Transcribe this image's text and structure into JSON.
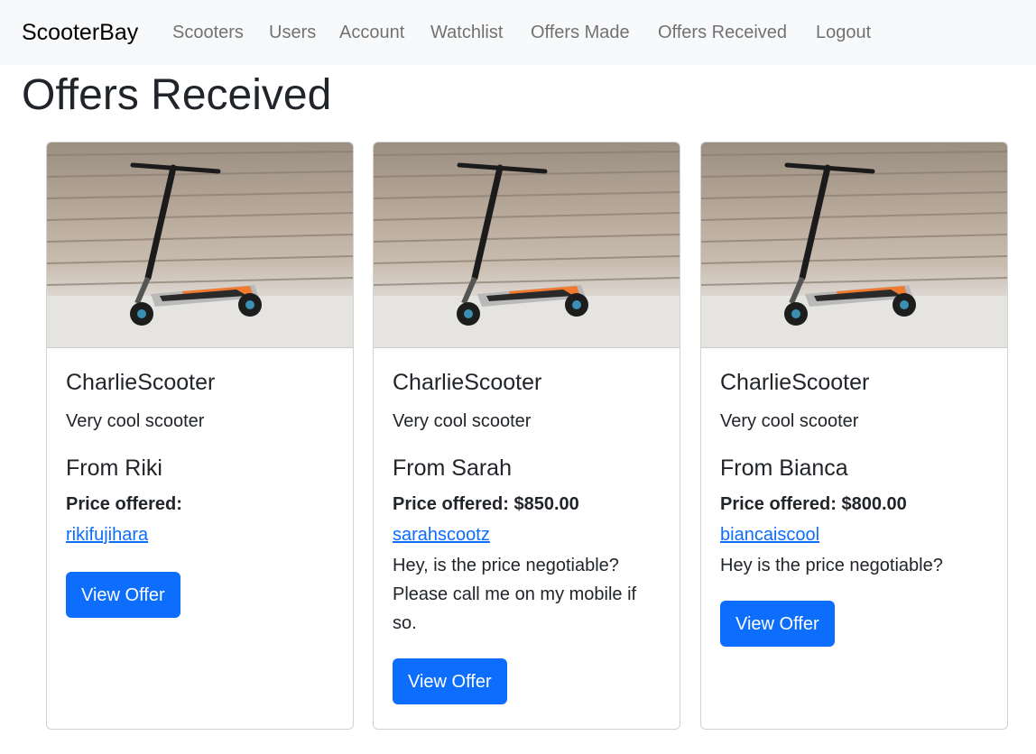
{
  "navbar": {
    "brand": "ScooterBay",
    "links": [
      "Scooters",
      "Users",
      "Account",
      "Watchlist",
      "Offers Made",
      "Offers Received",
      "Logout"
    ]
  },
  "page": {
    "title": "Offers Received"
  },
  "offers": [
    {
      "scooter_name": "CharlieScooter",
      "description": "Very cool scooter",
      "from": "From Riki",
      "price": "Price offered:",
      "username": "rikifujihara",
      "message": "",
      "button": "View Offer"
    },
    {
      "scooter_name": "CharlieScooter",
      "description": "Very cool scooter",
      "from": "From Sarah",
      "price": "Price offered: $850.00",
      "username": "sarahscootz",
      "message": "Hey, is the price negotiable? Please call me on my mobile if so.",
      "button": "View Offer"
    },
    {
      "scooter_name": "CharlieScooter",
      "description": "Very cool scooter",
      "from": "From Bianca",
      "price": "Price offered: $800.00",
      "username": "biancaiscool",
      "message": "Hey is the price negotiable?",
      "button": "View Offer"
    }
  ],
  "colors": {
    "primary": "#0d6efd",
    "navbar_bg": "#f8f9fa",
    "link": "#0d6efd"
  }
}
